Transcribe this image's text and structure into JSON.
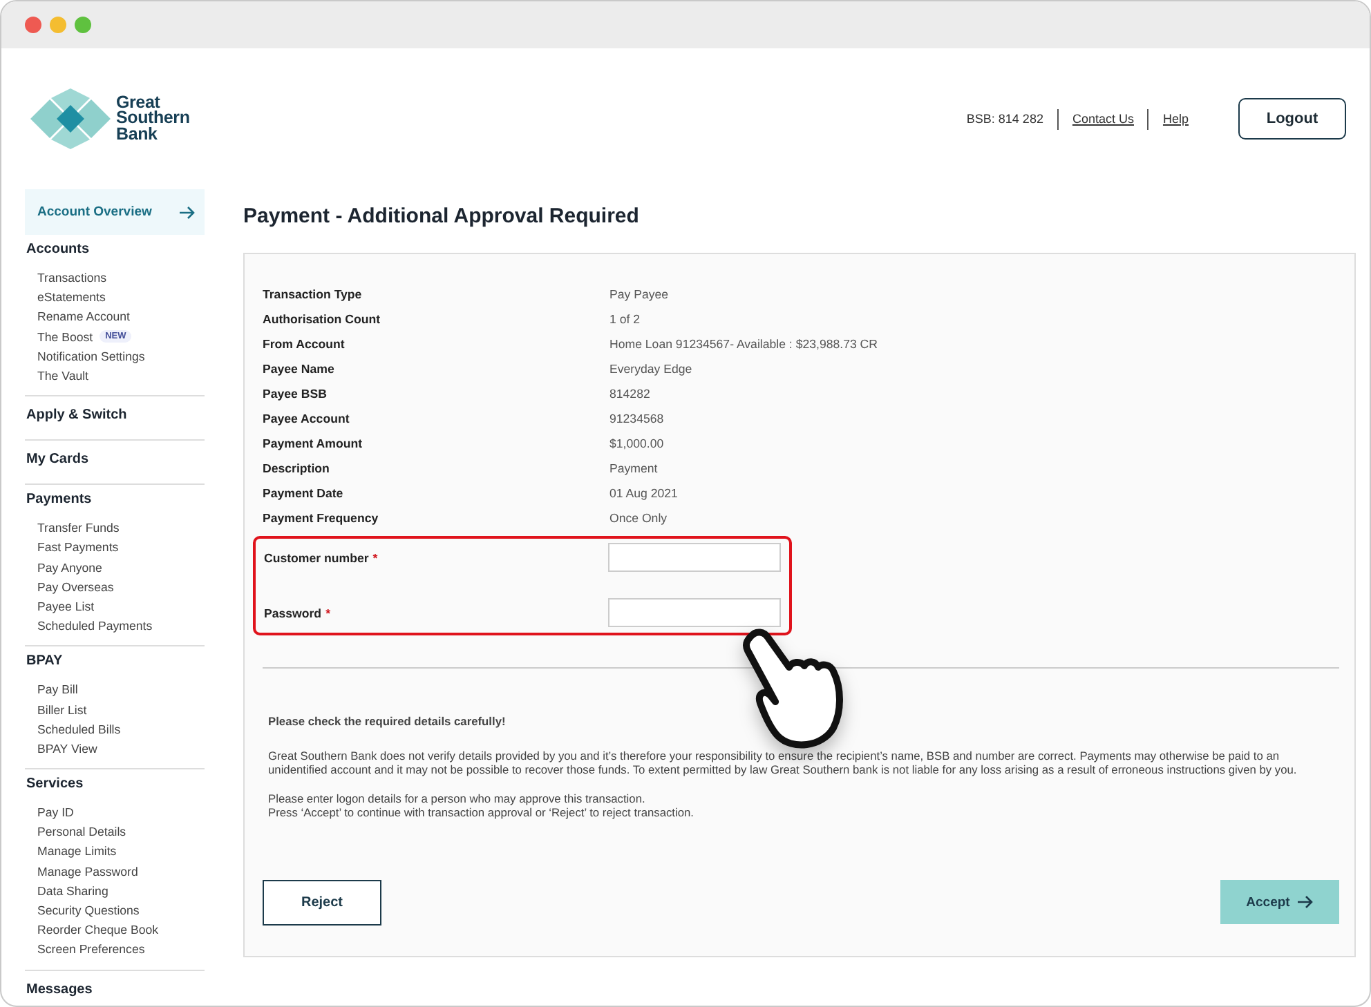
{
  "header": {
    "brand": [
      "Great",
      "Southern",
      "Bank"
    ],
    "bsb": "BSB: 814 282",
    "links": [
      "Contact Us",
      "Help"
    ],
    "logout": "Logout"
  },
  "sidebar": {
    "overview": {
      "label": "Account Overview",
      "selected": true
    },
    "sections": [
      {
        "title": "Accounts",
        "items": [
          {
            "label": "Transactions"
          },
          {
            "label": "eStatements"
          },
          {
            "label": "Rename Account"
          },
          {
            "label": "The Boost",
            "badge": "NEW"
          },
          {
            "label": "Notification Settings"
          },
          {
            "label": "The Vault"
          }
        ]
      },
      {
        "title": "Apply & Switch"
      },
      {
        "title": "My Cards"
      },
      {
        "title": "Payments",
        "items": [
          {
            "label": "Transfer Funds"
          },
          {
            "label": "Fast Payments"
          },
          {
            "label": "Pay Anyone"
          },
          {
            "label": "Pay Overseas"
          },
          {
            "label": "Payee List"
          },
          {
            "label": "Scheduled Payments"
          }
        ]
      },
      {
        "title": "BPAY",
        "items": [
          {
            "label": "Pay Bill"
          },
          {
            "label": "Biller List"
          },
          {
            "label": "Scheduled Bills"
          },
          {
            "label": "BPAY View"
          }
        ]
      },
      {
        "title": "Services",
        "items": [
          {
            "label": "Pay ID"
          },
          {
            "label": "Personal Details"
          },
          {
            "label": "Manage Limits"
          },
          {
            "label": "Manage Password"
          },
          {
            "label": "Data Sharing"
          },
          {
            "label": "Security Questions"
          },
          {
            "label": "Reorder Cheque Book"
          },
          {
            "label": "Screen Preferences"
          }
        ]
      },
      {
        "title": "Messages"
      }
    ]
  },
  "page_title": "Payment - Additional Approval Required",
  "details": [
    {
      "label": "Transaction Type",
      "value": "Pay Payee"
    },
    {
      "label": "Authorisation Count",
      "value": "1 of 2"
    },
    {
      "label": "From Account",
      "value": "Home Loan 91234567- Available : $23,988.73 CR"
    },
    {
      "label": "Payee Name",
      "value": "Everyday Edge"
    },
    {
      "label": "Payee BSB",
      "value": "814282"
    },
    {
      "label": "Payee Account",
      "value": "91234568"
    },
    {
      "label": "Payment Amount",
      "value": "$1,000.00"
    },
    {
      "label": "Description",
      "value": "Payment"
    },
    {
      "label": "Payment Date",
      "value": "01 Aug 2021"
    },
    {
      "label": "Payment Frequency",
      "value": "Once Only"
    }
  ],
  "fields": [
    {
      "label": "Customer number",
      "marker": "*"
    },
    {
      "label": "Password",
      "marker": "*"
    }
  ],
  "notes": {
    "heading": "Please check the required details carefully!",
    "paragraph": "Great Southern Bank does not verify details provided by you and it’s therefore your responsibility to ensure the recipient’s name, BSB and number are correct. Payments may otherwise be paid to an unidentified account and it may not be possible to recover those funds. To extent permitted by law Great Southern bank is not liable for any loss arising as a result of erroneous instructions given by you.",
    "lines": [
      "Please enter logon details for a person who may approve this transaction.",
      "Press ‘Accept’ to continue with transaction approval or ‘Reject’ to reject transaction."
    ]
  },
  "buttons": {
    "reject": "Reject",
    "accept": "Accept"
  }
}
